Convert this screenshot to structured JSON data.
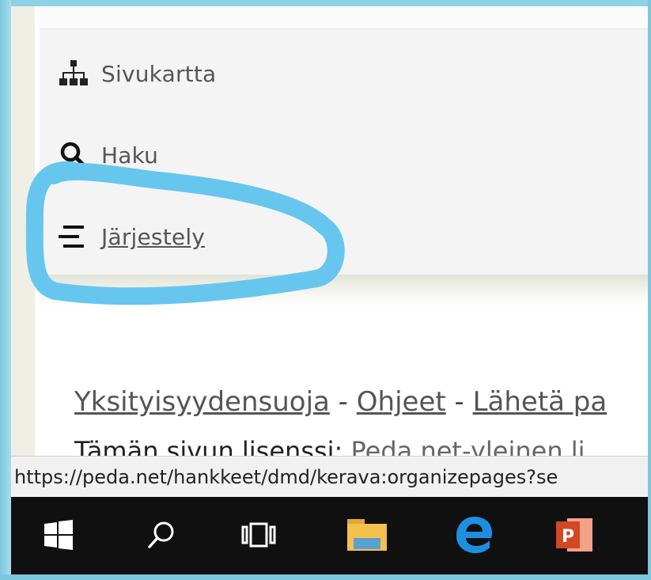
{
  "menu": {
    "items": [
      {
        "label": "Sivukartta",
        "icon": "sitemap-icon"
      },
      {
        "label": "Haku",
        "icon": "search-icon"
      },
      {
        "label": "Järjestely",
        "icon": "organize-icon"
      }
    ]
  },
  "footer": {
    "privacy": "Yksityisyydensuoja",
    "sep1": " - ",
    "help": "Ohjeet",
    "sep2": " - ",
    "send": "Lähetä pa",
    "license_prefix": "Tämän sivun lisenssi:",
    "license_link": "Peda.net-yleinen li"
  },
  "status_bar": {
    "url": "https://peda.net/hankkeet/dmd/kerava:organizepages?se"
  },
  "taskbar": {
    "items": [
      "windows-start-icon",
      "search-icon",
      "task-view-icon",
      "file-explorer-icon",
      "edge-icon",
      "powerpoint-icon"
    ]
  },
  "colors": {
    "highlight": "#67c6ee",
    "taskbar": "#101010"
  }
}
